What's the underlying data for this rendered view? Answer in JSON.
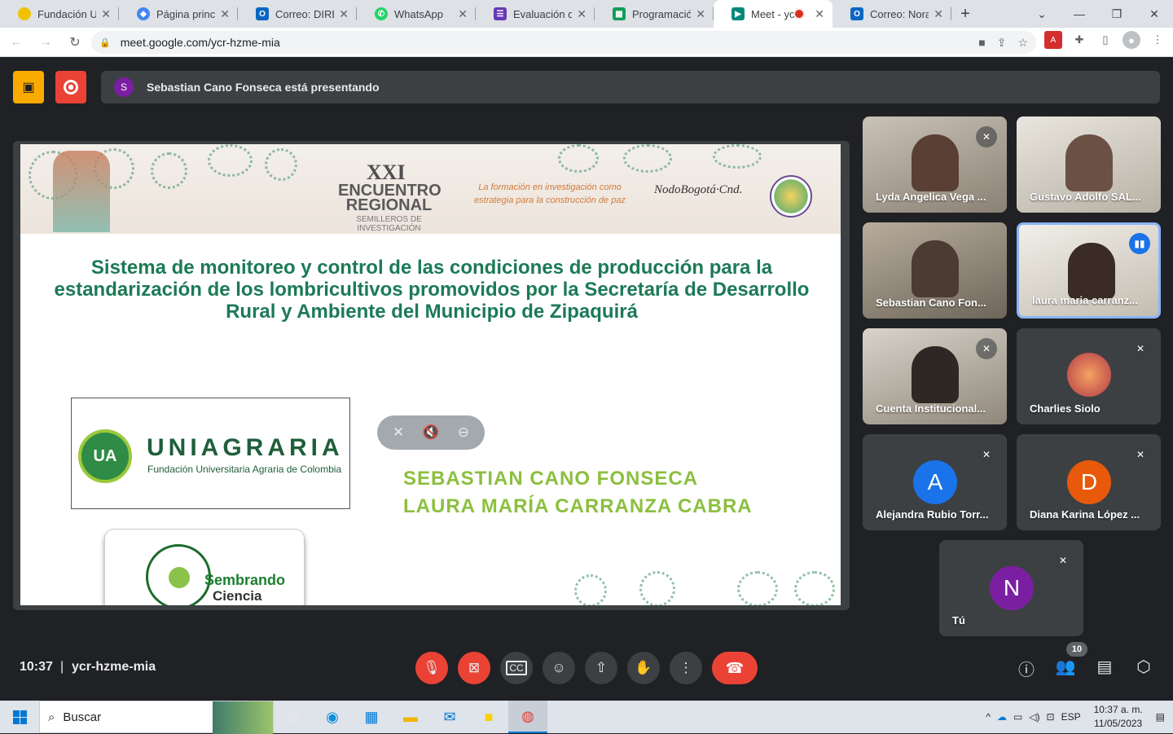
{
  "browser": {
    "tabs": [
      {
        "title": "Fundación Univ",
        "icon": "fundacion-icon",
        "color": "#f2c200"
      },
      {
        "title": "Página principa",
        "icon": "google-drive-icon",
        "color": "#4285f4"
      },
      {
        "title": "Correo: DIRECT",
        "icon": "outlook-icon",
        "color": "#0a66c2"
      },
      {
        "title": "WhatsApp",
        "icon": "whatsapp-icon",
        "color": "#25d366"
      },
      {
        "title": "Evaluación de p",
        "icon": "forms-icon",
        "color": "#673ab7"
      },
      {
        "title": "Programación",
        "icon": "sheets-icon",
        "color": "#0f9d58"
      },
      {
        "title": "Meet - ycr-",
        "icon": "meet-icon",
        "color": "#00897b"
      },
      {
        "title": "Correo: Nora M",
        "icon": "outlook-icon",
        "color": "#0a66c2"
      }
    ],
    "url": "meet.google.com/ycr-hzme-mia"
  },
  "meet": {
    "presenter_initial": "S",
    "presenter_banner": "Sebastian Cano Fonseca está presentando",
    "slide": {
      "xxi": "XXI",
      "encuentro": "ENCUENTRO REGIONAL",
      "semilleros": "SEMILLEROS DE INVESTIGACIÓN",
      "formacion": "La formación en investigación como estrategia para la construcción de paz",
      "nodo": "NodoBogotá·Cnd.",
      "title": "Sistema de monitoreo y control de las condiciones de producción para la estandarización de los lombricultivos promovidos por la Secretaría de Desarrollo Rural y Ambiente del Municipio de Zipaquirá",
      "ua_initials": "UA",
      "ua_name": "UNIAGRARIA",
      "ua_sub": "Fundación Universitaria Agraria de Colombia",
      "sc_line1": "Sembrando",
      "sc_line2": "Ciencia",
      "author1": "SEBASTIAN CANO FONSECA",
      "author2": "LAURA MARÍA CARRANZA CABRA"
    },
    "participants": [
      {
        "name": "Lyda Angelica Vega ...",
        "muted": true
      },
      {
        "name": "Gustavo Adolfo SAL...",
        "muted": false
      },
      {
        "name": "Sebastian Cano Fon...",
        "muted": false
      },
      {
        "name": "laura maria carranz...",
        "speaking": true
      },
      {
        "name": "Cuenta Institucional...",
        "muted": true
      },
      {
        "name": "Charlies Siolo",
        "muted": true
      },
      {
        "name": "Alejandra Rubio Torr...",
        "initial": "A",
        "color": "#1a73e8",
        "muted": true
      },
      {
        "name": "Diana Karina López ...",
        "initial": "D",
        "color": "#e8590c",
        "muted": true
      },
      {
        "name": "Tú",
        "initial": "N",
        "color": "#7b1fa2",
        "muted": true
      }
    ],
    "time": "10:37",
    "meeting_code": "ycr-hzme-mia",
    "participant_count": "10"
  },
  "taskbar": {
    "search_placeholder": "Buscar",
    "lang": "ESP",
    "time": "10:37 a. m.",
    "date": "11/05/2023"
  }
}
